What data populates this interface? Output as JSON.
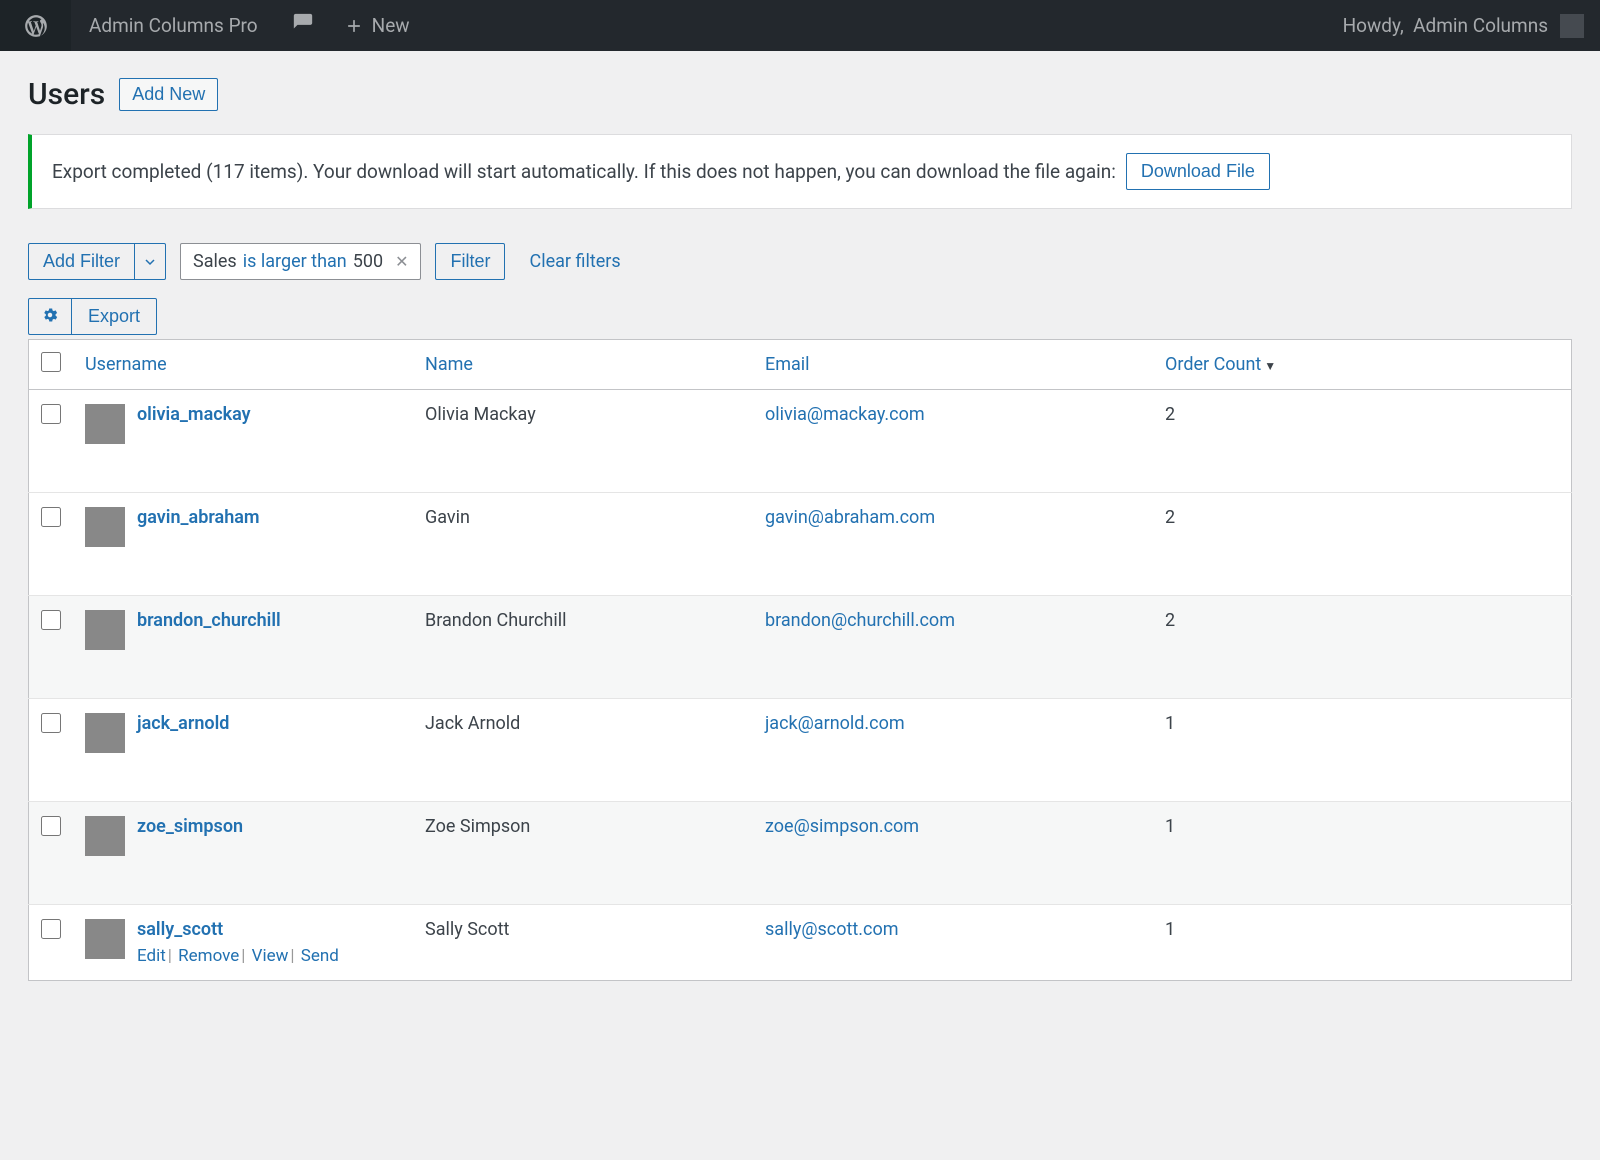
{
  "adminbar": {
    "site_name": "Admin Columns Pro",
    "new_label": "New",
    "howdy_prefix": "Howdy,",
    "howdy_name": "Admin Columns"
  },
  "page": {
    "title": "Users",
    "add_new": "Add New"
  },
  "notice": {
    "text": "Export completed (117 items). Your download will start automatically. If this does not happen, you can download the file again:",
    "download_btn": "Download File"
  },
  "filters": {
    "add_filter": "Add Filter",
    "chip_field": "Sales",
    "chip_operator": "is larger than",
    "chip_value": "500",
    "filter_btn": "Filter",
    "clear_label": "Clear filters",
    "export_label": "Export"
  },
  "table": {
    "headers": {
      "username": "Username",
      "name": "Name",
      "email": "Email",
      "order_count": "Order Count"
    },
    "rows": [
      {
        "username": "olivia_mackay",
        "name": "Olivia Mackay",
        "email": "olivia@mackay.com",
        "order_count": "2",
        "actions": false
      },
      {
        "username": "gavin_abraham",
        "name": "Gavin",
        "email": "gavin@abraham.com",
        "order_count": "2",
        "actions": false
      },
      {
        "username": "brandon_churchill",
        "name": "Brandon Churchill",
        "email": "brandon@churchill.com",
        "order_count": "2",
        "actions": false
      },
      {
        "username": "jack_arnold",
        "name": "Jack Arnold",
        "email": "jack@arnold.com",
        "order_count": "1",
        "actions": false
      },
      {
        "username": "zoe_simpson",
        "name": "Zoe Simpson",
        "email": "zoe@simpson.com",
        "order_count": "1",
        "actions": false
      },
      {
        "username": "sally_scott",
        "name": "Sally Scott",
        "email": "sally@scott.com",
        "order_count": "1",
        "actions": true
      }
    ],
    "row_actions": {
      "edit": "Edit",
      "remove": "Remove",
      "view": "View",
      "send": "Send"
    }
  }
}
